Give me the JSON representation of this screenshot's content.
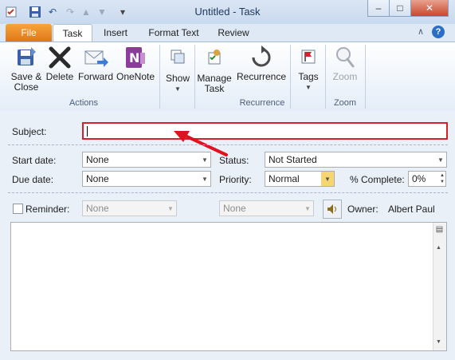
{
  "window": {
    "title": "Untitled  -  Task",
    "minimize": "–",
    "maximize": "□",
    "close": "✕"
  },
  "tabs": [
    {
      "label": "File"
    },
    {
      "label": "Task"
    },
    {
      "label": "Insert"
    },
    {
      "label": "Format Text"
    },
    {
      "label": "Review"
    }
  ],
  "ribbon": {
    "actions": {
      "save_close": "Save & Close",
      "delete": "Delete",
      "forward": "Forward",
      "onenote": "OneNote",
      "group_label": "Actions"
    },
    "show": {
      "label": "Show"
    },
    "manage_task": {
      "label": "Manage Task"
    },
    "recurrence": {
      "label": "Recurrence",
      "group_label": "Recurrence"
    },
    "tags": {
      "label": "Tags"
    },
    "zoom": {
      "label": "Zoom",
      "group_label": "Zoom"
    }
  },
  "form": {
    "subject_label": "Subject:",
    "subject_value": "",
    "start_label": "Start date:",
    "start_value": "None",
    "due_label": "Due date:",
    "due_value": "None",
    "status_label": "Status:",
    "status_value": "Not Started",
    "priority_label": "Priority:",
    "priority_value": "Normal",
    "complete_label": "% Complete:",
    "complete_value": "0%",
    "reminder_label": "Reminder:",
    "reminder_date": "None",
    "reminder_time": "None",
    "owner_label": "Owner:",
    "owner_value": "Albert Paul"
  },
  "colors": {
    "file_tab": "#e87d1e",
    "subject_highlight": "#d7202c",
    "arrow": "#e0121f"
  }
}
